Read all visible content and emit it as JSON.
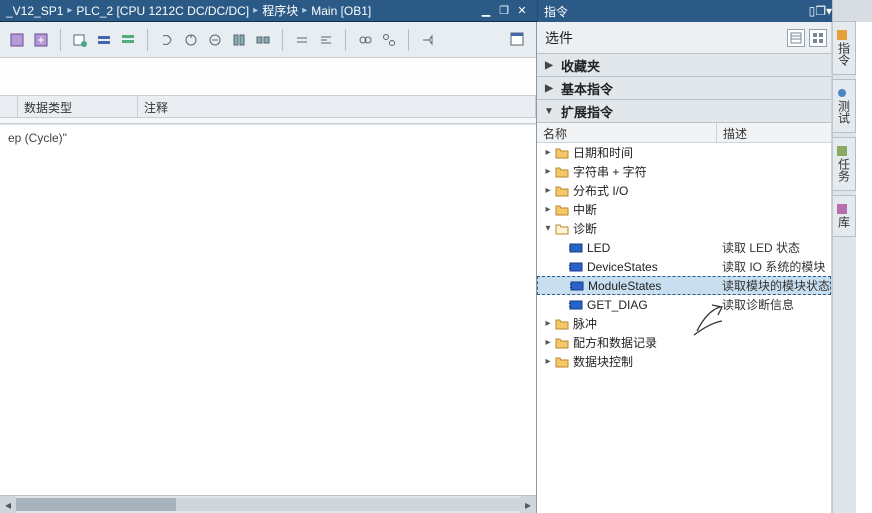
{
  "breadcrumb": [
    "_V12_SP1",
    "PLC_2 [CPU 1212C DC/DC/DC]",
    "程序块",
    "Main [OB1]"
  ],
  "title_right": "指令",
  "options_header": "选件",
  "main_cols": {
    "col_type": "数据类型",
    "col_comment": "注释"
  },
  "body_text": "ep (Cycle)\"",
  "sections": {
    "fav": "收藏夹",
    "basic": "基本指令",
    "ext": "扩展指令"
  },
  "tree_cols": {
    "name": "名称",
    "desc": "描述"
  },
  "tree": {
    "datetime": "日期和时间",
    "string": "字符串 + 字符",
    "distio": "分布式 I/O",
    "interrupt": "中断",
    "diag": "诊断",
    "led": "LED",
    "led_desc": "读取 LED 状态",
    "devstates": "DeviceStates",
    "devstates_desc": "读取 IO 系统的模块",
    "modstates": "ModuleStates",
    "modstates_desc": "读取模块的模块状态",
    "getdiag": "GET_DIAG",
    "getdiag_desc": "读取诊断信息",
    "pulse": "脉冲",
    "recipe": "配方和数据记录",
    "dbctrl": "数据块控制"
  },
  "sidetabs": {
    "cmd": "指令",
    "test": "测试",
    "task": "任务",
    "lib": "库"
  }
}
